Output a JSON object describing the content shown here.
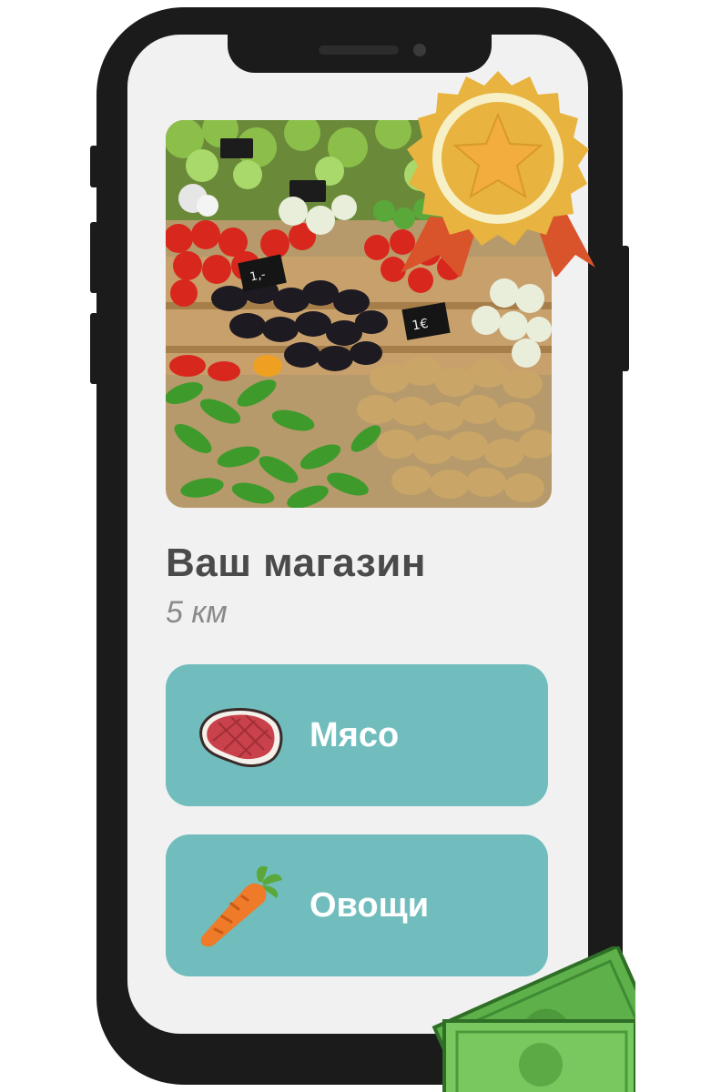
{
  "store": {
    "name": "Ваш магазин",
    "distance": "5 км"
  },
  "categories": [
    {
      "label": "Мясо",
      "icon": "meat-steak-icon"
    },
    {
      "label": "Овощи",
      "icon": "carrot-icon"
    }
  ],
  "photo": {
    "price_tags": [
      "1,-",
      "1€"
    ]
  },
  "colors": {
    "button_bg": "#71bdbd",
    "badge_gold": "#e8b33e",
    "ribbon": "#d9542b",
    "money_green": "#6dc35a",
    "title_text": "#4a4a4a"
  }
}
